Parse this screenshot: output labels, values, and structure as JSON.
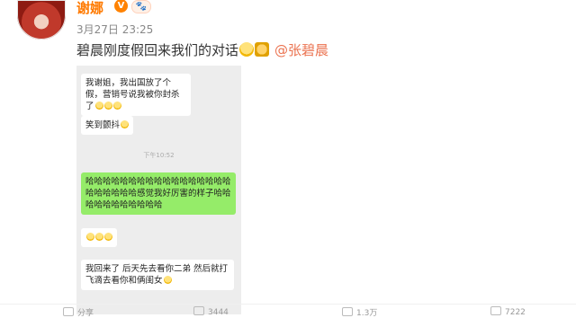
{
  "post": {
    "username": "谢娜",
    "verified_badge": "V",
    "fan_badge": "🐾",
    "timestamp": "3月27日 23:25",
    "text": "碧晨刚度假回来我们的对话",
    "mention": "@张碧晨",
    "emoji_icon": "laughing-cry-icon",
    "beer_icon": "cheers-icon"
  },
  "chat": {
    "msg1": "我谢姐，我出国放了个假，营销号说我被你封杀了",
    "msg2": "笑到颤抖",
    "time": "下午10:52",
    "reply": "哈哈哈哈哈哈哈哈哈哈哈哈哈哈哈哈哈哈哈哈哈哈哈感觉我好厉害的样子哈哈哈哈哈哈哈哈哈哈哈",
    "msg3": "",
    "msg4": "我回来了 后天先去看你二弟 然后就打飞滴去看你和俩闺女"
  },
  "toolbar": {
    "share": "分享",
    "comment_count": "3444",
    "like_count": "1.3万",
    "extra_count": "7222"
  },
  "colors": {
    "accent": "#ff7a00",
    "mention": "#eb7350",
    "chat_mine": "#95ec69",
    "chat_bg": "#ededed"
  }
}
